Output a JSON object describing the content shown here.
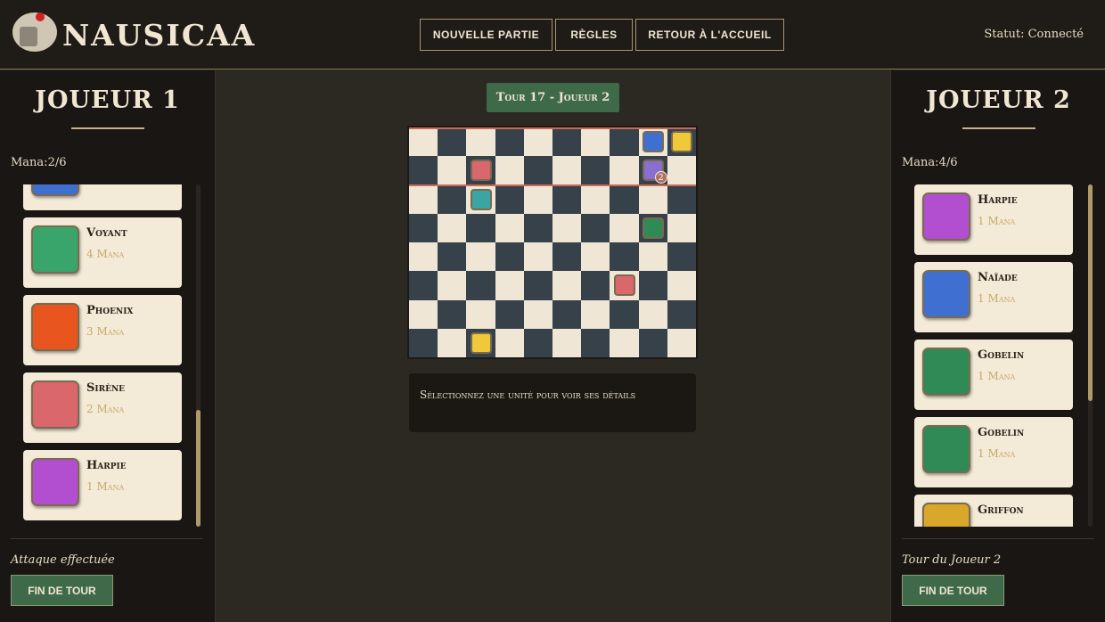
{
  "header": {
    "title": "NAUSICAA",
    "nav": [
      "NOUVELLE PARTIE",
      "RÈGLES",
      "RETOUR À L'ACCUEIL"
    ],
    "status": "Statut: Connecté"
  },
  "player1": {
    "title": "JOUEUR 1",
    "mana": "Mana:2/6",
    "cards": [
      {
        "name": "",
        "cost": "",
        "icon": "naiade-icon",
        "color": "#3f6fd1"
      },
      {
        "name": "Voyant",
        "cost": "4 Mana",
        "icon": "voyant-icon",
        "color": "#3aa56a"
      },
      {
        "name": "Phoenix",
        "cost": "3 Mana",
        "icon": "phoenix-icon",
        "color": "#e8551e"
      },
      {
        "name": "Sirène",
        "cost": "2 Mana",
        "icon": "sirene-icon",
        "color": "#d9676c"
      },
      {
        "name": "Harpie",
        "cost": "1 Mana",
        "icon": "harpie-icon",
        "color": "#b24fd1"
      }
    ],
    "message": "Attaque effectuée",
    "end_turn": "FIN DE TOUR"
  },
  "player2": {
    "title": "JOUEUR 2",
    "mana": "Mana:4/6",
    "cards": [
      {
        "name": "Harpie",
        "cost": "1 Mana",
        "icon": "harpie-icon",
        "color": "#b24fd1"
      },
      {
        "name": "Naïade",
        "cost": "1 Mana",
        "icon": "naiade-icon",
        "color": "#3f6fd1"
      },
      {
        "name": "Gobelin",
        "cost": "1 Mana",
        "icon": "gobelin-icon",
        "color": "#2f8a55"
      },
      {
        "name": "Gobelin",
        "cost": "1 Mana",
        "icon": "gobelin-icon",
        "color": "#2f8a55"
      },
      {
        "name": "Griffon",
        "cost": "",
        "icon": "griffon-icon",
        "color": "#d9a82a"
      }
    ],
    "message": "Tour du Joueur 2",
    "end_turn": "FIN DE TOUR"
  },
  "turn": "Tour 17 - Joueur 2",
  "board": {
    "cols": 10,
    "rows": 8,
    "pieces": [
      {
        "col": 8,
        "row": 0,
        "icon": "naiade-icon",
        "color": "#3f6fd1"
      },
      {
        "col": 9,
        "row": 0,
        "icon": "crown-icon",
        "color": "#f0c93a"
      },
      {
        "col": 2,
        "row": 1,
        "icon": "sirene-icon",
        "color": "#d9676c"
      },
      {
        "col": 8,
        "row": 1,
        "icon": "spectre-icon",
        "color": "#8a6fd0",
        "badge": "2"
      },
      {
        "col": 2,
        "row": 2,
        "icon": "sirene-icon",
        "color": "#3aa5a5"
      },
      {
        "col": 8,
        "row": 3,
        "icon": "gobelin-icon",
        "color": "#2f8a55"
      },
      {
        "col": 7,
        "row": 5,
        "icon": "sirene-icon",
        "color": "#d9676c"
      },
      {
        "col": 2,
        "row": 7,
        "icon": "crown-icon",
        "color": "#f0c93a"
      }
    ]
  },
  "info": "Sélectionnez une unité pour voir ses détails"
}
